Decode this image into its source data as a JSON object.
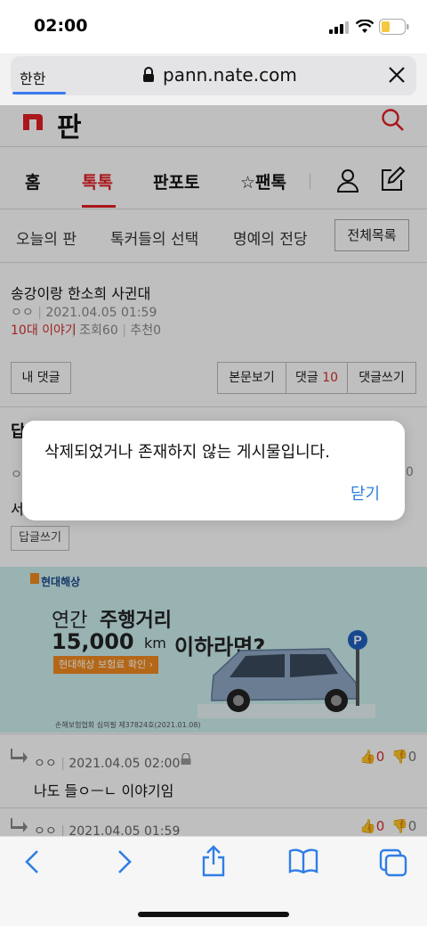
{
  "status_bar": {
    "time": "02:00",
    "signal_icon": "signal-icon",
    "wifi_icon": "wifi-icon",
    "battery_icon": "battery-icon",
    "battery_color": "#f5c842"
  },
  "browser": {
    "text_size_label": "한한",
    "url": "pann.nate.com",
    "lock_icon": "lock-icon",
    "close_icon": "close-icon"
  },
  "site": {
    "logo_text": "판",
    "brand_color": "#e21f26",
    "nav": [
      {
        "label": "홈",
        "active": false
      },
      {
        "label": "톡톡",
        "active": true
      },
      {
        "label": "판포토",
        "active": false
      },
      {
        "label": "☆팬톡",
        "active": false
      }
    ],
    "sub_nav": [
      "오늘의 판",
      "톡커들의 선택",
      "명예의 전당"
    ],
    "full_list_button": "전체목록"
  },
  "post": {
    "title": "송강이랑 한소희 사귄대",
    "author": "ㅇㅇ",
    "date": "2021.04.05 01:59",
    "category": "10대 이야기",
    "views": "조회60",
    "recommends": "추천0"
  },
  "post_buttons": {
    "my_comments": "내 댓글",
    "view_post": "본문보기",
    "comments_label": "댓글",
    "comments_count": "10",
    "write_comment": "댓글쓰기"
  },
  "comments_section": {
    "header_partial": "답",
    "first_comment_author_partial": "ㅇ",
    "first_comment_text_partial": "서",
    "first_comment_count_partial": "0",
    "reply_button": "답글쓰기"
  },
  "ad": {
    "brand": "현대해상",
    "line1_a": "연간",
    "line1_b": "주행거리",
    "line2_digits": "15,000",
    "line2_km": "km",
    "line2_limit": "이하라면?",
    "cta": "현대해상 보험료 확인 ›",
    "disclaimer": "손해보험협회 심의필 제37824호(2021.01.08)"
  },
  "comments": [
    {
      "author": "ㅇㅇ",
      "date": "2021.04.05 02:00",
      "text": "나도 들ㅇㅡㄴ 이야기임",
      "up": "0",
      "down": "0"
    },
    {
      "author": "ㅇㅇ",
      "date": "2021.04.05 01:59",
      "text": "",
      "up": "0",
      "down": "0"
    }
  ],
  "alert": {
    "message": "삭제되었거나 존재하지 않는 게시물입니다.",
    "close_label": "닫기"
  },
  "toolbar": {
    "back_icon": "back-icon",
    "forward_icon": "forward-icon",
    "share_icon": "share-icon",
    "bookmarks_icon": "bookmarks-icon",
    "tabs_icon": "tabs-icon",
    "accent": "#2f7ee6"
  }
}
